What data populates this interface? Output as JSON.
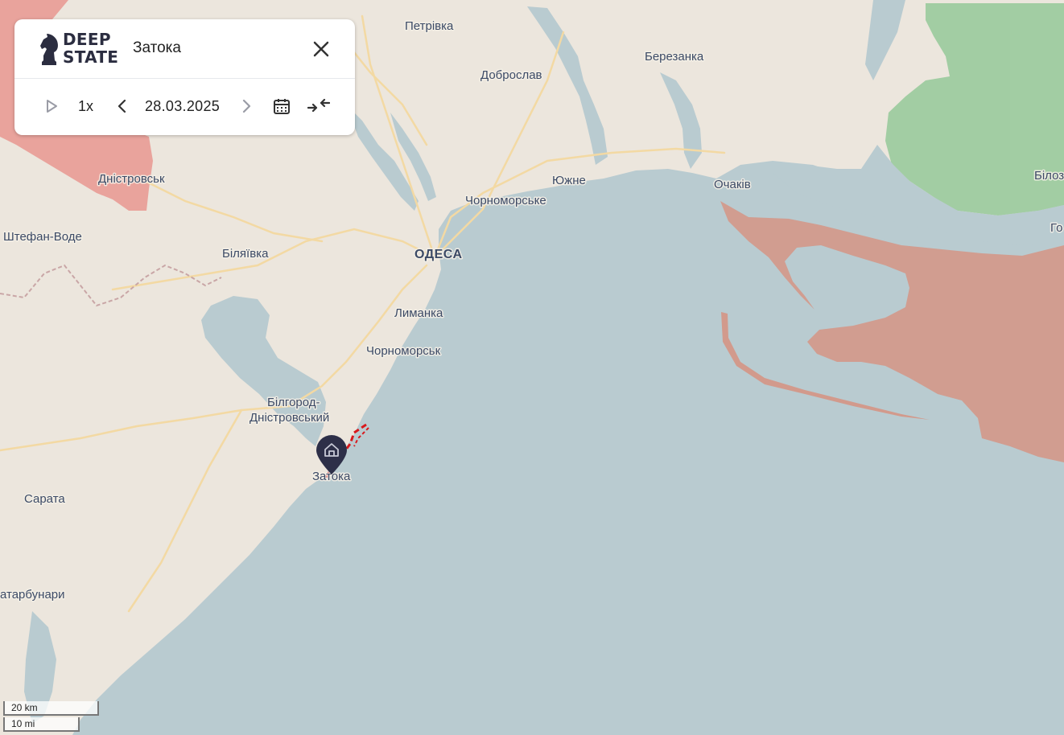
{
  "panel": {
    "logo_line1": "DEEP",
    "logo_line2": "STATE",
    "place_title": "Затока",
    "speed": "1x",
    "date": "28.03.2025"
  },
  "map": {
    "labels": [
      {
        "text": "Петрівка",
        "role": "city"
      },
      {
        "text": "Березанка",
        "role": "city"
      },
      {
        "text": "Доброслав",
        "role": "city"
      },
      {
        "text": "Дністровськ",
        "role": "city"
      },
      {
        "text": "Южне",
        "role": "city"
      },
      {
        "text": "Очаків",
        "role": "city"
      },
      {
        "text": "Чорноморське",
        "role": "city"
      },
      {
        "text": "Штефан-Воде",
        "role": "city"
      },
      {
        "text": "Біляївка",
        "role": "city"
      },
      {
        "text": "ОДЕСА",
        "role": "capital"
      },
      {
        "text": "Лиманка",
        "role": "city"
      },
      {
        "text": "Чорноморськ",
        "role": "city"
      },
      {
        "text": "Білгород-",
        "role": "city"
      },
      {
        "text": "Дністровський",
        "role": "city"
      },
      {
        "text": "Затока",
        "role": "city"
      },
      {
        "text": "Сарата",
        "role": "city"
      },
      {
        "text": "атарбунари",
        "role": "city"
      },
      {
        "text": "Білоз",
        "role": "city"
      },
      {
        "text": "Го",
        "role": "city"
      }
    ],
    "colors": {
      "sea": "#b9cbd0",
      "land": "#ece6dd",
      "occupied": "#d29a8c",
      "liberated": "#9ecb9f",
      "road": "#f5dcaa",
      "strike_line": "#d8191c"
    }
  },
  "scale": {
    "km": "20 km",
    "mi": "10 mi"
  },
  "icons": [
    "play-icon",
    "chevron-left-icon",
    "chevron-right-icon",
    "calendar-icon",
    "compress-icon",
    "close-icon",
    "home-icon",
    "knight-logo-icon"
  ]
}
